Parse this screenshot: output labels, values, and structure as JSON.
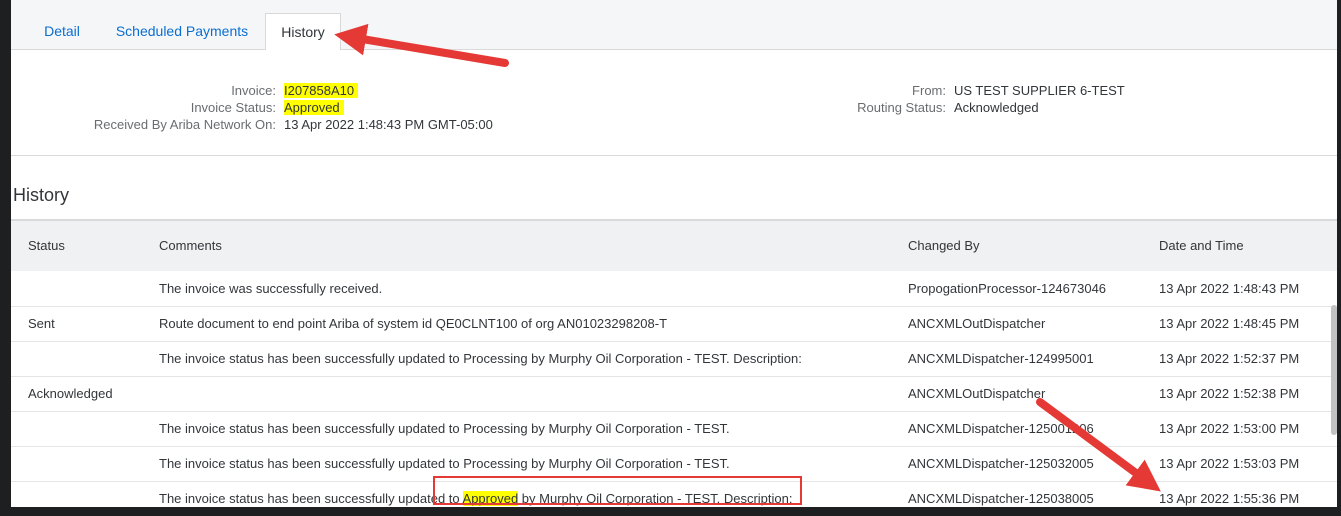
{
  "tabs": [
    {
      "label": "Detail"
    },
    {
      "label": "Scheduled Payments"
    },
    {
      "label": "History"
    }
  ],
  "invoice_info": {
    "invoice_label": "Invoice:",
    "invoice_value": "I207858A10",
    "status_label": "Invoice Status:",
    "status_value": "Approved",
    "received_label": "Received By Ariba Network On:",
    "received_value": "13 Apr 2022 1:48:43 PM GMT-05:00",
    "from_label": "From:",
    "from_value": "US TEST SUPPLIER 6-TEST",
    "routing_label": "Routing Status:",
    "routing_value": "Acknowledged"
  },
  "history": {
    "title": "History",
    "columns": [
      "Status",
      "Comments",
      "Changed By",
      "Date and Time"
    ],
    "rows": [
      {
        "status": "",
        "comment": "The invoice was successfully received.",
        "changed_by": "PropogationProcessor-124673046",
        "date": "13 Apr 2022 1:48:43 PM"
      },
      {
        "status": "Sent",
        "comment": "Route document to end point Ariba of system id QE0CLNT100 of org AN01023298208-T",
        "changed_by": "ANCXMLOutDispatcher",
        "date": "13 Apr 2022 1:48:45 PM"
      },
      {
        "status": "",
        "comment": "The invoice status has been successfully updated to Processing by Murphy Oil Corporation - TEST. Description:",
        "changed_by": "ANCXMLDispatcher-124995001",
        "date": "13 Apr 2022 1:52:37 PM"
      },
      {
        "status": "Acknowledged",
        "comment": "",
        "changed_by": "ANCXMLOutDispatcher",
        "date": "13 Apr 2022 1:52:38 PM"
      },
      {
        "status": "",
        "comment": "The invoice status has been successfully updated to Processing by Murphy Oil Corporation - TEST.",
        "changed_by": "ANCXMLDispatcher-125001206",
        "date": "13 Apr 2022 1:53:00 PM"
      },
      {
        "status": "",
        "comment": "The invoice status has been successfully updated to Processing by Murphy Oil Corporation - TEST.",
        "changed_by": "ANCXMLDispatcher-125032005",
        "date": "13 Apr 2022 1:53:03 PM"
      },
      {
        "status": "",
        "comment_pre": "The invoice status has been successfully updated to ",
        "comment_hl": "Approved",
        "comment_post": " by Murphy Oil Corporation - TEST. Description:",
        "changed_by": "ANCXMLDispatcher-125038005",
        "date": "13 Apr 2022 1:55:36 PM"
      }
    ]
  },
  "colors": {
    "link_blue": "#0a6ed1",
    "highlight_yellow": "#ffff00",
    "annotation_red": "#e53935"
  }
}
